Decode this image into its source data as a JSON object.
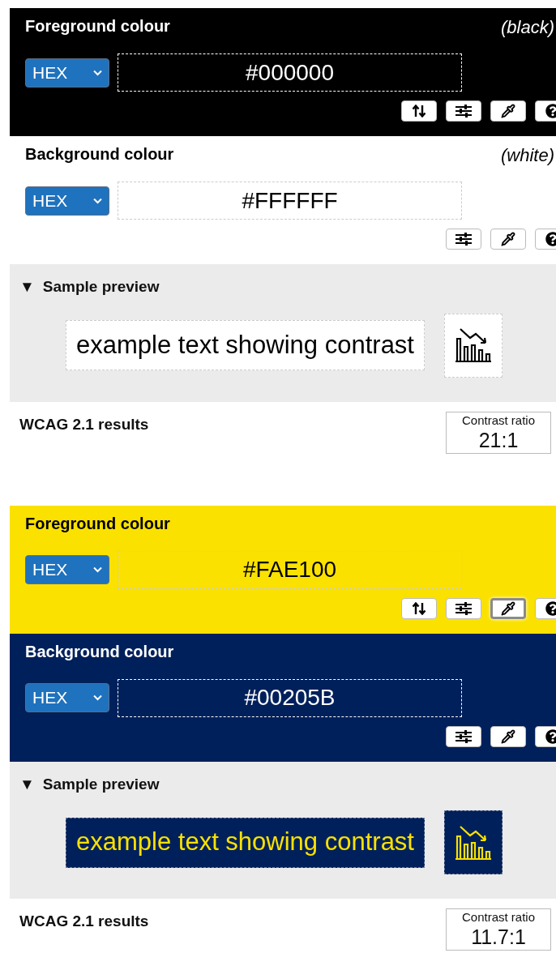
{
  "panels": [
    {
      "foreground": {
        "label": "Foreground colour",
        "colour_name": "(black)",
        "format": "HEX",
        "value": "#000000",
        "tools": [
          {
            "kind": "swap",
            "selected": false
          },
          {
            "kind": "adjust",
            "selected": false
          },
          {
            "kind": "picker",
            "selected": false
          },
          {
            "kind": "help",
            "selected": false
          }
        ]
      },
      "background": {
        "label": "Background colour",
        "colour_name": "(white)",
        "format": "HEX",
        "value": "#FFFFFF",
        "tools": [
          {
            "kind": "adjust",
            "selected": false
          },
          {
            "kind": "picker",
            "selected": false
          },
          {
            "kind": "help",
            "selected": false
          }
        ]
      },
      "preview": {
        "toggle": "▼",
        "title": "Sample preview",
        "text": "example text showing contrast"
      },
      "results": {
        "title": "WCAG 2.1 results",
        "ratio_label": "Contrast ratio",
        "ratio": "21:1"
      }
    },
    {
      "foreground": {
        "label": "Foreground colour",
        "format": "HEX",
        "value": "#FAE100",
        "tools": [
          {
            "kind": "swap",
            "selected": false
          },
          {
            "kind": "adjust",
            "selected": false
          },
          {
            "kind": "picker",
            "selected": true
          },
          {
            "kind": "help",
            "selected": false
          }
        ]
      },
      "background": {
        "label": "Background colour",
        "format": "HEX",
        "value": "#00205B",
        "tools": [
          {
            "kind": "adjust",
            "selected": false
          },
          {
            "kind": "picker",
            "selected": false
          },
          {
            "kind": "help",
            "selected": false
          }
        ]
      },
      "preview": {
        "toggle": "▼",
        "title": "Sample preview",
        "text": "example text showing contrast"
      },
      "results": {
        "title": "WCAG 2.1 results",
        "ratio_label": "Contrast ratio",
        "ratio": "11.7:1"
      }
    }
  ]
}
